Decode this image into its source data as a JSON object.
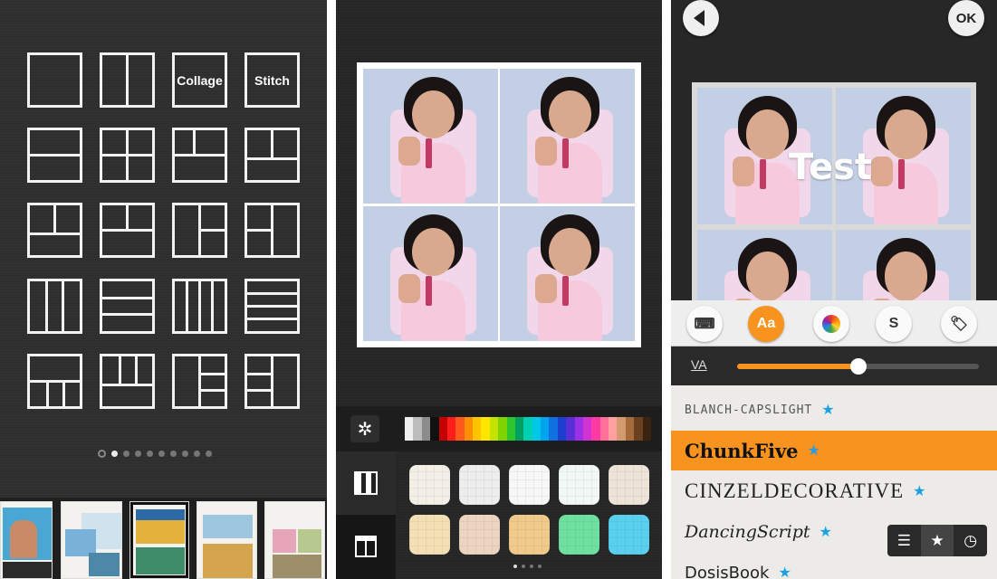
{
  "layout_panel": {
    "collage_label": "Collage",
    "stitch_label": "Stitch",
    "page_count": 9,
    "active_page": 1
  },
  "background_panel": {
    "shuffle_icon": "shuffle-icon",
    "tab_patterns_icon": "checkerboard-icon",
    "tab_premium_icon": "gift-icon",
    "spectrum": [
      "#efefef",
      "#bcbcbc",
      "#8c8c8c",
      "#111111",
      "#c50000",
      "#ff1c1c",
      "#ff5a1c",
      "#ff8f00",
      "#ffc400",
      "#ffe600",
      "#c6e200",
      "#7fd400",
      "#2ec52e",
      "#00a060",
      "#00d0b0",
      "#00c8e6",
      "#00a4ef",
      "#1170e0",
      "#1d3fcf",
      "#5a2fd6",
      "#9b30e6",
      "#d232d2",
      "#ff3aa5",
      "#ff6f9a",
      "#ff9f9f",
      "#d29a6e",
      "#a56b3a",
      "#6a4020",
      "#3a2410"
    ],
    "patterns": [
      "#f3efe6",
      "#ededed",
      "#f7f7f7",
      "#f2f8f6",
      "#ede3d6",
      "#f4dfb4",
      "#ecd5c0",
      "#f0c98b",
      "#6fe0a0",
      "#5ad0ef"
    ],
    "page_count": 4,
    "active_page": 0
  },
  "text_panel": {
    "back_icon": "back-arrow-icon",
    "ok_label": "OK",
    "overlay_text": "Test",
    "tools": [
      {
        "name": "keyboard",
        "icon": "keyboard-icon",
        "glyph": "⌨"
      },
      {
        "name": "font",
        "icon": "font-icon",
        "glyph": "Aa"
      },
      {
        "name": "color",
        "icon": "color-wheel-icon",
        "glyph": ""
      },
      {
        "name": "style",
        "icon": "style-icon",
        "glyph": "S"
      },
      {
        "name": "tag",
        "icon": "tag-icon",
        "glyph": "🏷"
      }
    ],
    "active_tool": 1,
    "spacing_label": "VA",
    "spacing_value": 0.5,
    "fonts": [
      {
        "label": "Blanch-CapsLight",
        "starred": true
      },
      {
        "label": "ChunkFive",
        "starred": true
      },
      {
        "label": "CinzelDecorative",
        "starred": true
      },
      {
        "label": "DancingScript",
        "starred": true
      },
      {
        "label": "DosisBook",
        "starred": true
      }
    ],
    "active_font": 1,
    "view_modes": [
      {
        "icon": "list-icon",
        "glyph": "☰"
      },
      {
        "icon": "star-icon",
        "glyph": "★"
      },
      {
        "icon": "clock-icon",
        "glyph": "◷"
      }
    ],
    "active_view": 1
  }
}
